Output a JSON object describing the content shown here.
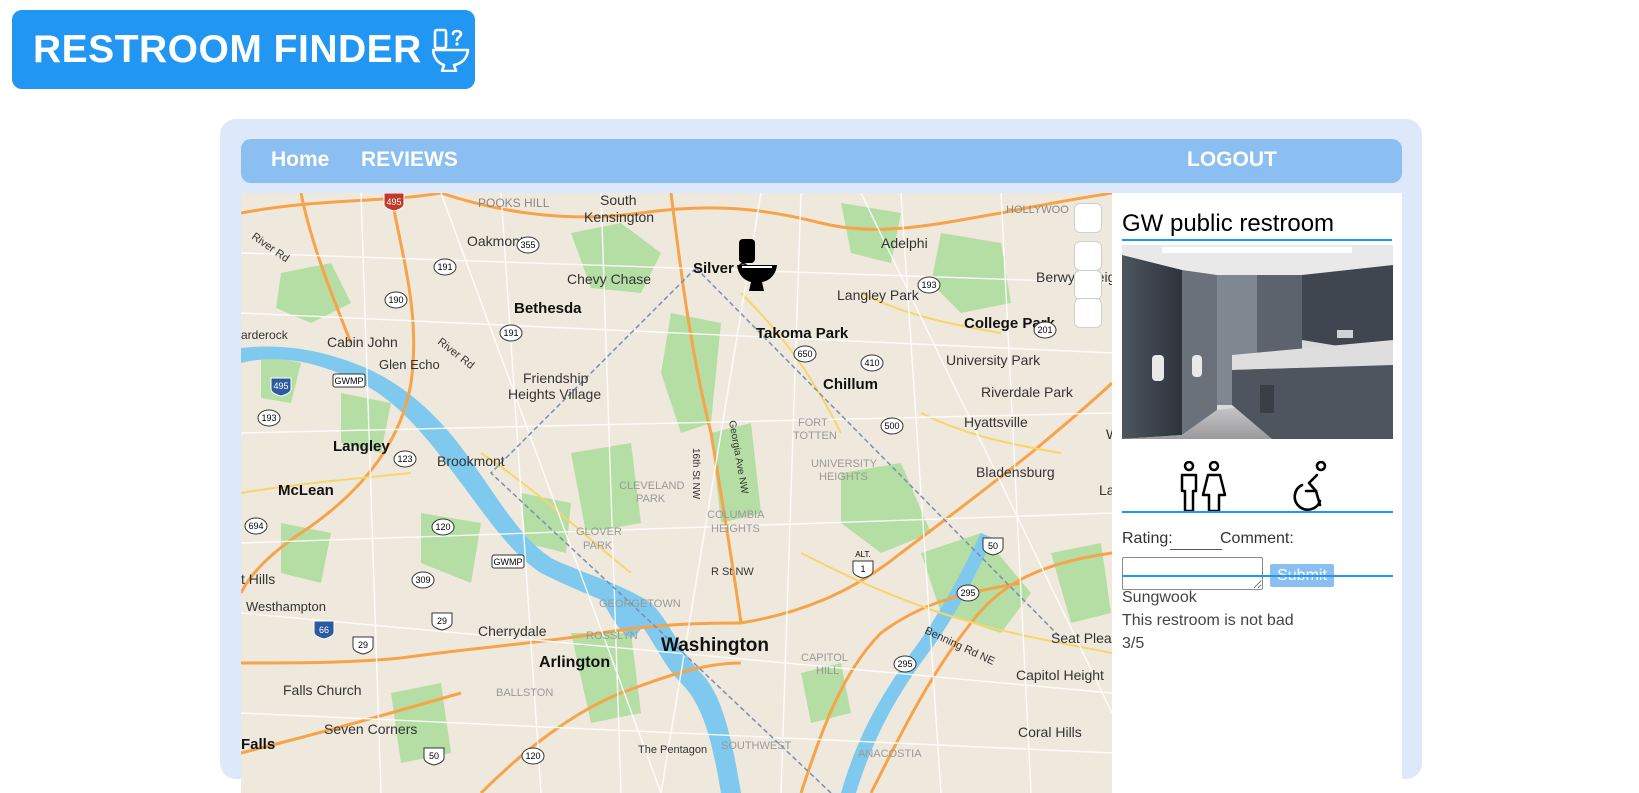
{
  "brand": {
    "title": "RESTROOM FINDER",
    "icon": "toilet-question-icon"
  },
  "nav": {
    "home": "Home",
    "reviews": "REVIEWS",
    "logout": "LOGOUT"
  },
  "map": {
    "marker_icon": "toilet-icon",
    "labels": {
      "south_kensington_1": "South",
      "south_kensington_2": "Kensington",
      "pooks_hill": "POOKS HILL",
      "oakmont": "Oakmont",
      "adelphi": "Adelphi",
      "hollywood": "HOLLYWOO",
      "chevy_chase": "Chevy Chase",
      "silver_spring": "Silver Sp",
      "berwyn": "Berwyn Heig",
      "langley_park": "Langley Park",
      "bethesda": "Bethesda",
      "college_park": "College Park",
      "arderock": "arderock",
      "cabin_john": "Cabin John",
      "takoma_park": "Takoma Park",
      "glen_echo": "Glen Echo",
      "university_park": "University Park",
      "friendship_1": "Friendship",
      "friendship_2": "Heights Village",
      "chillum": "Chillum",
      "riverdale_park": "Riverdale Park",
      "hyattsville": "Hyattsville",
      "fort_totten_1": "FORT",
      "fort_totten_2": "TOTTEN",
      "langley": "Langley",
      "brookmont": "Brookmont",
      "university_heights_1": "UNIVERSITY",
      "university_heights_2": "HEIGHTS",
      "bladensburg": "Bladensburg",
      "mclean": "McLean",
      "cleveland_park_1": "CLEVELAND",
      "cleveland_park_2": "PARK",
      "la": "La",
      "columbia_heights_1": "COLUMBIA",
      "columbia_heights_2": "HEIGHTS",
      "glover_park_1": "GLOVER",
      "glover_park_2": "PARK",
      "r_st": "R St NW",
      "hills": "t Hills",
      "westhampton": "Westhampton",
      "georgetown": "GEORGETOWN",
      "cherrydale": "Cherrydale",
      "rosslyn": "ROSSLYN",
      "washington": "Washington",
      "arlington": "Arlington",
      "capitol_hill_1": "CAPITOL",
      "capitol_hill_2": "HILL",
      "seat_pleasant": "Seat Plea",
      "falls_church": "Falls Church",
      "ballston": "BALLSTON",
      "capitol_heights": "Capitol Height",
      "seven_corners": "Seven Corners",
      "coral_hills": "Coral Hills",
      "falls": "Falls",
      "pentagon": "The Pentagon",
      "southwest": "SOUTHWEST",
      "anacostia": "ANACOSTIA",
      "river_rd_1": "River Rd",
      "river_rd_2": "River Rd",
      "benning_rd": "Benning Rd NE",
      "georgia_ave": "Georgia Ave NW",
      "sixteenth_st": "16th St NW",
      "gwmp_1": "GWMP",
      "gwmp_2": "GWMP",
      "w": "W",
      "alt": "ALT."
    },
    "shields": {
      "s495a": "495",
      "s495b": "495",
      "s355": "355",
      "s191": "191",
      "s190": "190",
      "s191b": "191",
      "s193": "193",
      "s201": "201",
      "s650": "650",
      "s410": "410",
      "s500": "500",
      "s193b": "193",
      "s123": "123",
      "s694": "694",
      "s120": "120",
      "s50": "50",
      "s1": "1",
      "s309": "309",
      "s295": "295",
      "s29a": "29",
      "s66": "66",
      "s29b": "29",
      "s295b": "295",
      "s50b": "50",
      "s120b": "120"
    }
  },
  "restroom": {
    "name": "GW public restroom",
    "amenity_icons": [
      "all-gender-restroom-icon",
      "wheelchair-accessible-icon"
    ],
    "rating_label": "Rating:",
    "rating_value": "",
    "comment_label": "Comment:",
    "comment_value": "",
    "submit_label": "Submit"
  },
  "reviews": [
    {
      "user": "Sungwook",
      "text": "This restroom is not bad",
      "rating": "3/5"
    }
  ],
  "colors": {
    "brand": "#2196f3",
    "nav": "#8bbff2",
    "panel": "#dde9fb"
  }
}
